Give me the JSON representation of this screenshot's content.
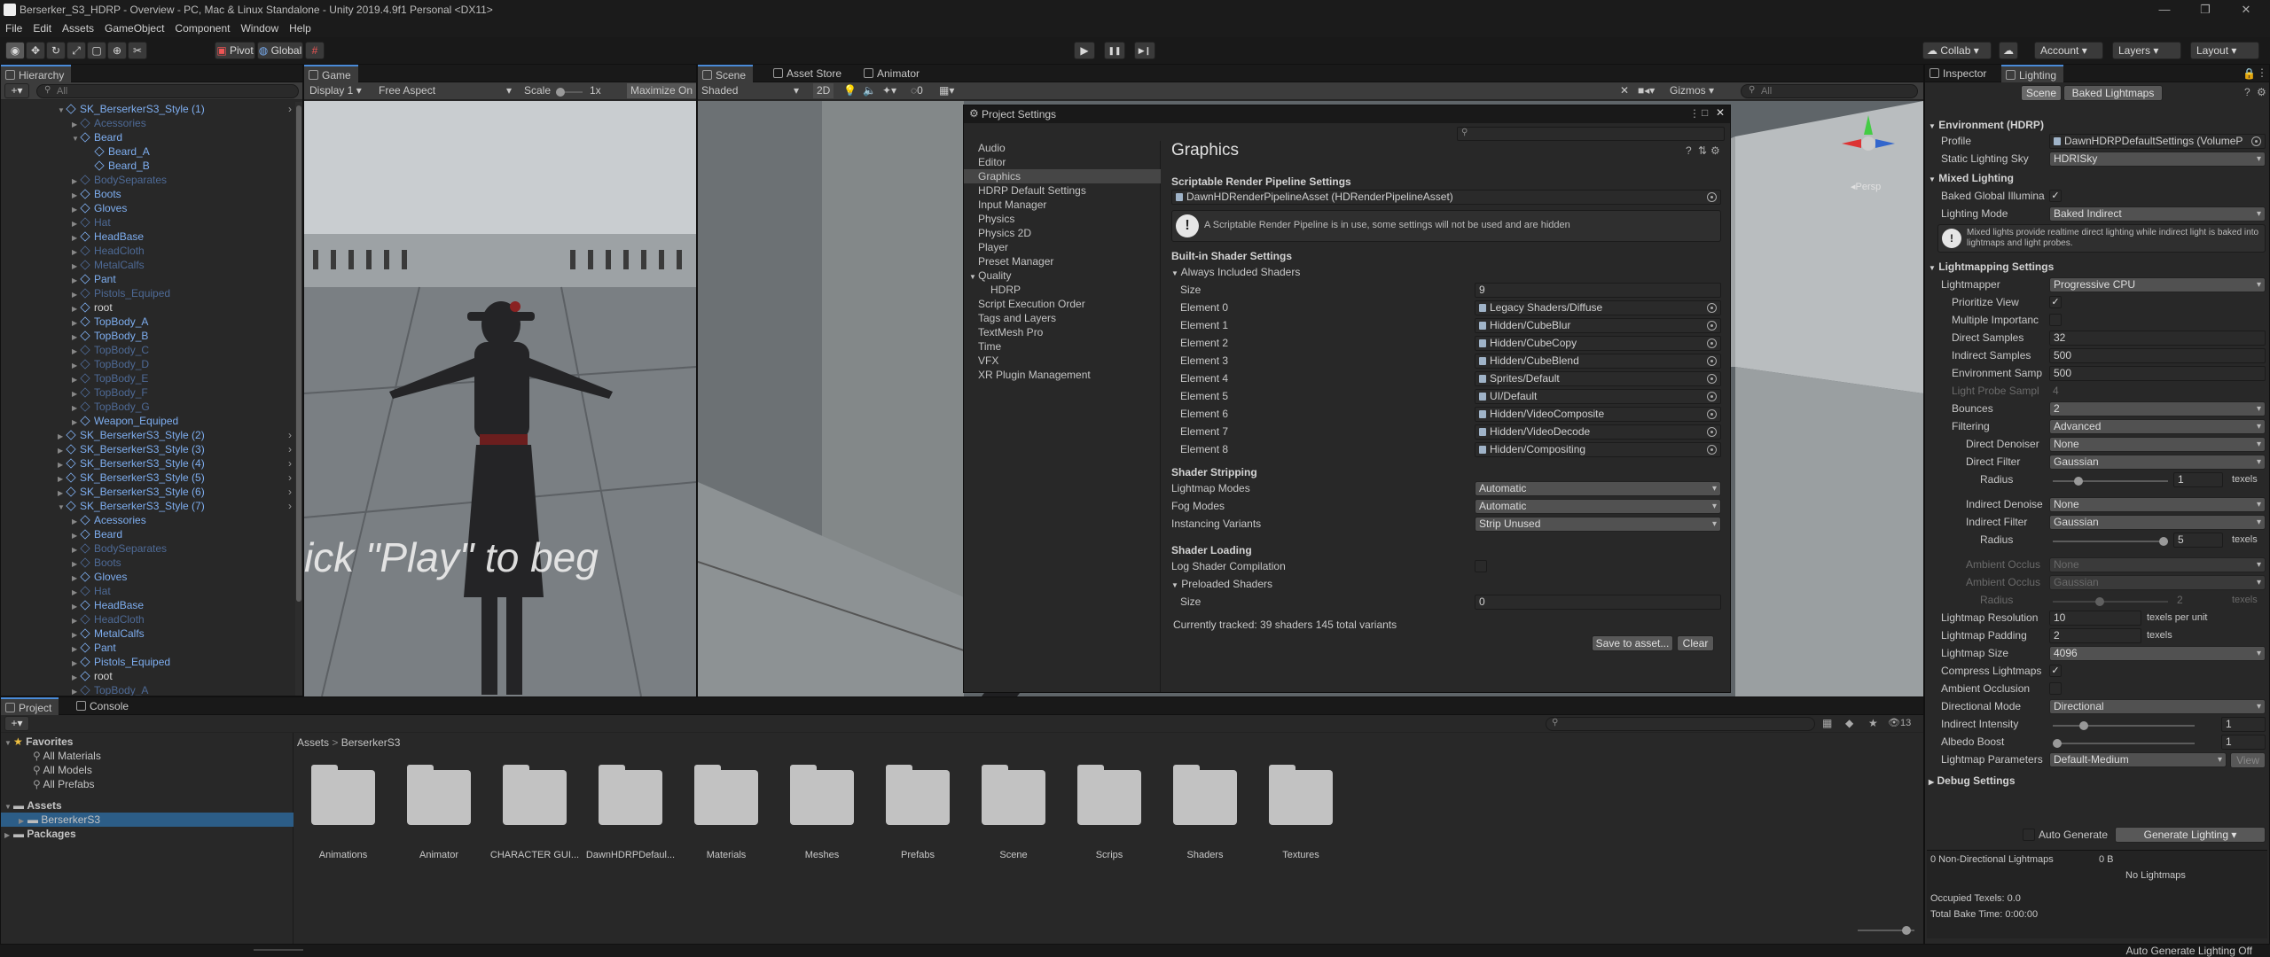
{
  "titlebar": {
    "title": "Berserker_S3_HDRP - Overview - PC, Mac & Linux Standalone - Unity 2019.4.9f1 Personal <DX11>",
    "min": "—",
    "max": "❐",
    "close": "✕"
  },
  "menu": [
    "File",
    "Edit",
    "Assets",
    "GameObject",
    "Component",
    "Window",
    "Help"
  ],
  "toolbar": {
    "pivot": "Pivot",
    "global": "Global",
    "play": "▶",
    "pause": "❚❚",
    "step": "▶❙",
    "collab": "Collab",
    "account": "Account",
    "layers": "Layers",
    "layout": "Layout"
  },
  "hierarchy": {
    "tab": "Hierarchy",
    "search_placeholder": "All",
    "rows": [
      {
        "label": "SK_BerserkerS3_Style (1)",
        "style": "blue",
        "indent": 0,
        "fold": "▼"
      },
      {
        "label": "Acessories",
        "style": "dim",
        "indent": 1,
        "fold": "▶"
      },
      {
        "label": "Beard",
        "style": "blue",
        "indent": 1,
        "fold": "▼"
      },
      {
        "label": "Beard_A",
        "style": "blue",
        "indent": 2,
        "fold": ""
      },
      {
        "label": "Beard_B",
        "style": "blue",
        "indent": 2,
        "fold": ""
      },
      {
        "label": "BodySeparates",
        "style": "dim",
        "indent": 1,
        "fold": "▶"
      },
      {
        "label": "Boots",
        "style": "blue",
        "indent": 1,
        "fold": "▶"
      },
      {
        "label": "Gloves",
        "style": "blue",
        "indent": 1,
        "fold": "▶"
      },
      {
        "label": "Hat",
        "style": "dim",
        "indent": 1,
        "fold": "▶"
      },
      {
        "label": "HeadBase",
        "style": "blue",
        "indent": 1,
        "fold": "▶"
      },
      {
        "label": "HeadCloth",
        "style": "dim",
        "indent": 1,
        "fold": "▶"
      },
      {
        "label": "MetalCalfs",
        "style": "dim",
        "indent": 1,
        "fold": "▶"
      },
      {
        "label": "Pant",
        "style": "blue",
        "indent": 1,
        "fold": "▶"
      },
      {
        "label": "Pistols_Equiped",
        "style": "dim",
        "indent": 1,
        "fold": "▶"
      },
      {
        "label": "root",
        "style": "white",
        "indent": 1,
        "fold": "▶"
      },
      {
        "label": "TopBody_A",
        "style": "blue",
        "indent": 1,
        "fold": "▶"
      },
      {
        "label": "TopBody_B",
        "style": "blue",
        "indent": 1,
        "fold": "▶"
      },
      {
        "label": "TopBody_C",
        "style": "dim",
        "indent": 1,
        "fold": "▶"
      },
      {
        "label": "TopBody_D",
        "style": "dim",
        "indent": 1,
        "fold": "▶"
      },
      {
        "label": "TopBody_E",
        "style": "dim",
        "indent": 1,
        "fold": "▶"
      },
      {
        "label": "TopBody_F",
        "style": "dim",
        "indent": 1,
        "fold": "▶"
      },
      {
        "label": "TopBody_G",
        "style": "dim",
        "indent": 1,
        "fold": "▶"
      },
      {
        "label": "Weapon_Equiped",
        "style": "blue",
        "indent": 1,
        "fold": "▶"
      },
      {
        "label": "SK_BerserkerS3_Style (2)",
        "style": "blue",
        "indent": 0,
        "fold": "▶"
      },
      {
        "label": "SK_BerserkerS3_Style (3)",
        "style": "blue",
        "indent": 0,
        "fold": "▶"
      },
      {
        "label": "SK_BerserkerS3_Style (4)",
        "style": "blue",
        "indent": 0,
        "fold": "▶"
      },
      {
        "label": "SK_BerserkerS3_Style (5)",
        "style": "blue",
        "indent": 0,
        "fold": "▶"
      },
      {
        "label": "SK_BerserkerS3_Style (6)",
        "style": "blue",
        "indent": 0,
        "fold": "▶"
      },
      {
        "label": "SK_BerserkerS3_Style (7)",
        "style": "blue",
        "indent": 0,
        "fold": "▼"
      },
      {
        "label": "Acessories",
        "style": "blue",
        "indent": 1,
        "fold": "▶"
      },
      {
        "label": "Beard",
        "style": "blue",
        "indent": 1,
        "fold": "▶"
      },
      {
        "label": "BodySeparates",
        "style": "dim",
        "indent": 1,
        "fold": "▶"
      },
      {
        "label": "Boots",
        "style": "dim",
        "indent": 1,
        "fold": "▶"
      },
      {
        "label": "Gloves",
        "style": "blue",
        "indent": 1,
        "fold": "▶"
      },
      {
        "label": "Hat",
        "style": "dim",
        "indent": 1,
        "fold": "▶"
      },
      {
        "label": "HeadBase",
        "style": "blue",
        "indent": 1,
        "fold": "▶"
      },
      {
        "label": "HeadCloth",
        "style": "dim",
        "indent": 1,
        "fold": "▶"
      },
      {
        "label": "MetalCalfs",
        "style": "blue",
        "indent": 1,
        "fold": "▶"
      },
      {
        "label": "Pant",
        "style": "blue",
        "indent": 1,
        "fold": "▶"
      },
      {
        "label": "Pistols_Equiped",
        "style": "blue",
        "indent": 1,
        "fold": "▶"
      },
      {
        "label": "root",
        "style": "white",
        "indent": 1,
        "fold": "▶"
      },
      {
        "label": "TopBody_A",
        "style": "dim",
        "indent": 1,
        "fold": "▶"
      }
    ]
  },
  "game": {
    "tab": "Game",
    "display": "Display 1",
    "aspect": "Free Aspect",
    "scale_label": "Scale",
    "scale_value": "1x",
    "maximize": "Maximize On",
    "overlay_text": "ick \"Play\" to beg"
  },
  "scene": {
    "tabs": [
      "Scene",
      "Asset Store",
      "Animator"
    ],
    "shading": "Shaded",
    "mode2d": "2D",
    "fx_count": "0",
    "gizmos": "Gizmos",
    "search_placeholder": "All",
    "persp": "Persp"
  },
  "project_settings": {
    "title": "Project Settings",
    "categories": [
      "Audio",
      "Editor",
      "Graphics",
      "HDRP Default Settings",
      "Input Manager",
      "Physics",
      "Physics 2D",
      "Player",
      "Preset Manager",
      "Quality",
      "HDRP",
      "Script Execution Order",
      "Tags and Layers",
      "TextMesh Pro",
      "Time",
      "VFX",
      "XR Plugin Management"
    ],
    "selected": "Graphics",
    "heading": "Graphics",
    "srp_header": "Scriptable Render Pipeline Settings",
    "srp_asset": "DawnHDRenderPipelineAsset (HDRenderPipelineAsset)",
    "srp_warning": "A Scriptable Render Pipeline is in use, some settings will not be used and are hidden",
    "builtin_header": "Built-in Shader Settings",
    "always_included": "Always Included Shaders",
    "size_label": "Size",
    "size_value": "9",
    "elements": [
      {
        "label": "Element 0",
        "value": "Legacy Shaders/Diffuse"
      },
      {
        "label": "Element 1",
        "value": "Hidden/CubeBlur"
      },
      {
        "label": "Element 2",
        "value": "Hidden/CubeCopy"
      },
      {
        "label": "Element 3",
        "value": "Hidden/CubeBlend"
      },
      {
        "label": "Element 4",
        "value": "Sprites/Default"
      },
      {
        "label": "Element 5",
        "value": "UI/Default"
      },
      {
        "label": "Element 6",
        "value": "Hidden/VideoComposite"
      },
      {
        "label": "Element 7",
        "value": "Hidden/VideoDecode"
      },
      {
        "label": "Element 8",
        "value": "Hidden/Compositing"
      }
    ],
    "stripping_header": "Shader Stripping",
    "stripping": [
      {
        "label": "Lightmap Modes",
        "value": "Automatic"
      },
      {
        "label": "Fog Modes",
        "value": "Automatic"
      },
      {
        "label": "Instancing Variants",
        "value": "Strip Unused"
      }
    ],
    "loading_header": "Shader Loading",
    "log_compile": "Log Shader Compilation",
    "preloaded": "Preloaded Shaders",
    "preloaded_size_label": "Size",
    "preloaded_size_value": "0",
    "tracked": "Currently tracked: 39 shaders 145 total variants",
    "save_btn": "Save to asset...",
    "clear_btn": "Clear"
  },
  "project": {
    "tabs": [
      "Project",
      "Console"
    ],
    "badge": "13",
    "favorites_header": "Favorites",
    "favorites": [
      "All Materials",
      "All Models",
      "All Prefabs"
    ],
    "assets_header": "Assets",
    "assets_child": "BerserkerS3",
    "packages": "Packages",
    "breadcrumb": [
      "Assets",
      "BerserkerS3"
    ],
    "folders": [
      "Animations",
      "Animator",
      "CHARACTER GUI...",
      "DawnHDRPDefaul...",
      "Materials",
      "Meshes",
      "Prefabs",
      "Scene",
      "Scrips",
      "Shaders",
      "Textures"
    ]
  },
  "inspector": {
    "tabs": [
      "Inspector",
      "Lighting"
    ],
    "modes": [
      "Scene",
      "Baked Lightmaps"
    ],
    "env_header": "Environment (HDRP)",
    "profile_label": "Profile",
    "profile_value": "DawnHDRPDefaultSettings (VolumeP",
    "sky_label": "Static Lighting Sky",
    "sky_value": "HDRISky",
    "mixed_header": "Mixed Lighting",
    "baked_gi_label": "Baked Global Illumina",
    "lighting_mode_label": "Lighting Mode",
    "lighting_mode_value": "Baked Indirect",
    "mixed_info": "Mixed lights provide realtime direct lighting while indirect light is baked into lightmaps and light probes.",
    "lm_header": "Lightmapping Settings",
    "lightmapper_label": "Lightmapper",
    "lightmapper_value": "Progressive CPU",
    "prioritize_label": "Prioritize View",
    "multiple_label": "Multiple Importanc",
    "direct_samples_label": "Direct Samples",
    "direct_samples": "32",
    "indirect_samples_label": "Indirect Samples",
    "indirect_samples": "500",
    "env_samples_label": "Environment Samp",
    "env_samples": "500",
    "probe_label": "Light Probe Sampl",
    "probe_value": "4",
    "bounces_label": "Bounces",
    "bounces_value": "2",
    "filtering_label": "Filtering",
    "filtering_value": "Advanced",
    "direct_denoiser_label": "Direct Denoiser",
    "direct_denoiser": "None",
    "direct_filter_label": "Direct Filter",
    "direct_filter": "Gaussian",
    "radius_label": "Radius",
    "radius1": "1",
    "radius1_frac": 0.2,
    "texels": "texels",
    "indirect_denoise_label": "Indirect Denoise",
    "indirect_denoise": "None",
    "indirect_filter_label": "Indirect Filter",
    "indirect_filter": "Gaussian",
    "radius2": "5",
    "radius2_frac": 1.0,
    "ao_label1": "Ambient Occlus",
    "ao_value1": "None",
    "ao_label2": "Ambient Occlus",
    "ao_value2": "Gaussian",
    "radius3": "2",
    "radius3_frac": 0.4,
    "lm_res_label": "Lightmap Resolution",
    "lm_res": "10",
    "texels_per_unit": "texels per unit",
    "lm_pad_label": "Lightmap Padding",
    "lm_pad": "2",
    "lm_size_label": "Lightmap Size",
    "lm_size": "4096",
    "compress_label": "Compress Lightmaps",
    "ao_label": "Ambient Occlusion",
    "dir_mode_label": "Directional Mode",
    "dir_mode": "Directional",
    "ind_int_label": "Indirect Intensity",
    "ind_int": "1",
    "ind_int_frac": 0.2,
    "albedo_label": "Albedo Boost",
    "albedo": "1",
    "albedo_frac": 0.0,
    "lm_params_label": "Lightmap Parameters",
    "lm_params": "Default-Medium",
    "view_btn": "View",
    "debug_header": "Debug Settings",
    "auto_generate": "Auto Generate",
    "generate_btn": "Generate Lighting",
    "stats_left": "0 Non-Directional Lightmaps",
    "stats_size": "0 B",
    "no_lightmaps": "No Lightmaps",
    "occupied": "Occupied Texels: 0.0",
    "bake_time": "Total Bake Time: 0:00:00"
  },
  "statusbar": {
    "text": "Auto Generate Lighting Off"
  }
}
